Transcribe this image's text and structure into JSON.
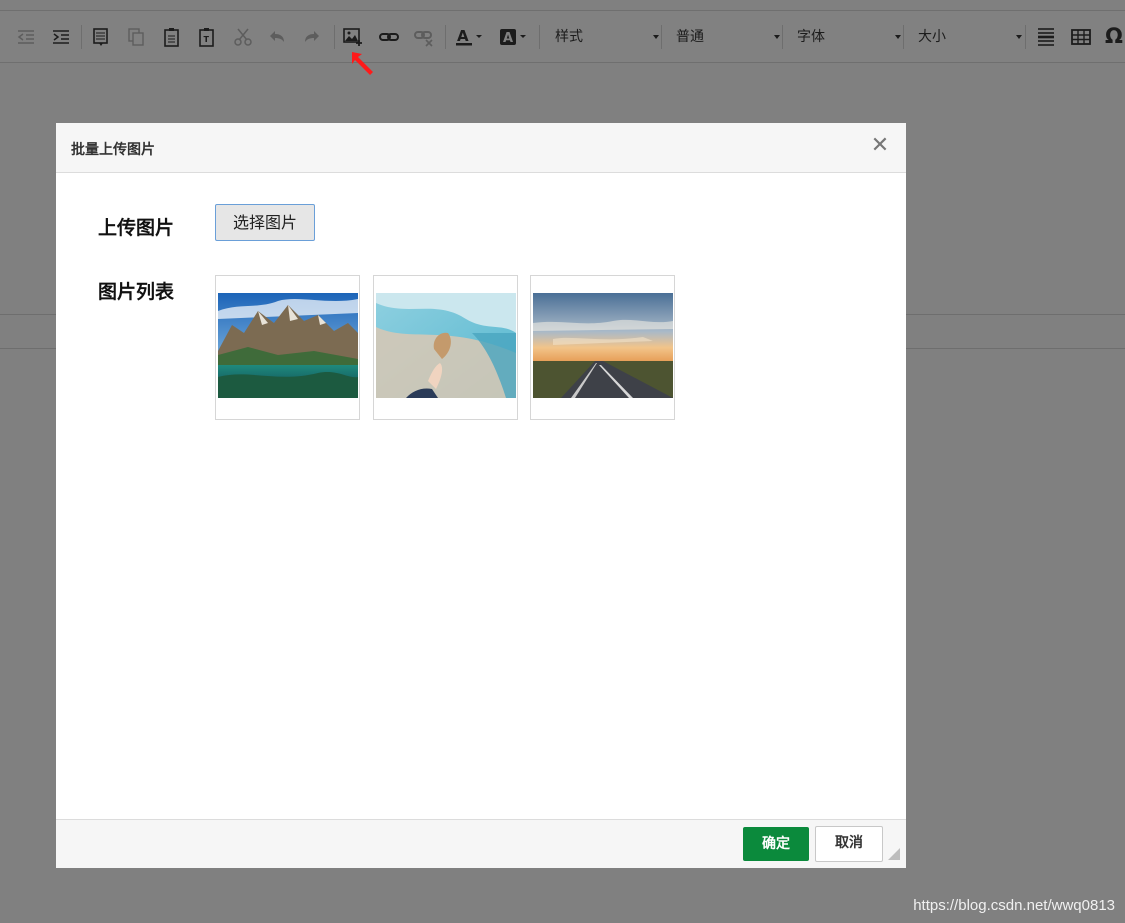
{
  "toolbar": {
    "selects": [
      {
        "label": "样式"
      },
      {
        "label": "普通"
      },
      {
        "label": "字体"
      },
      {
        "label": "大小"
      }
    ],
    "icons": [
      "indent-decrease-icon",
      "indent-increase-icon",
      "paste-text-icon",
      "copy-icon",
      "paste-icon",
      "paste-word-icon",
      "cut-icon",
      "undo-icon",
      "redo-icon",
      "insert-image-icon",
      "link-icon",
      "unlink-icon",
      "font-color-icon",
      "background-color-icon",
      "horizontal-rule-icon",
      "table-icon",
      "special-char-icon"
    ],
    "special_char": "Ω",
    "highlight_arrow_color": "#ff1a1a"
  },
  "dialog": {
    "title": "批量上传图片",
    "close_glyph": "✕",
    "upload_label": "上传图片",
    "pick_button": "选择图片",
    "list_label": "图片列表",
    "images": [
      {
        "alt": "mountain-lake"
      },
      {
        "alt": "beach-shell"
      },
      {
        "alt": "sunset-road"
      }
    ],
    "ok_label": "确定",
    "cancel_label": "取消",
    "accent": "#0b8a3c"
  },
  "watermark": "https://blog.csdn.net/wwq0813"
}
